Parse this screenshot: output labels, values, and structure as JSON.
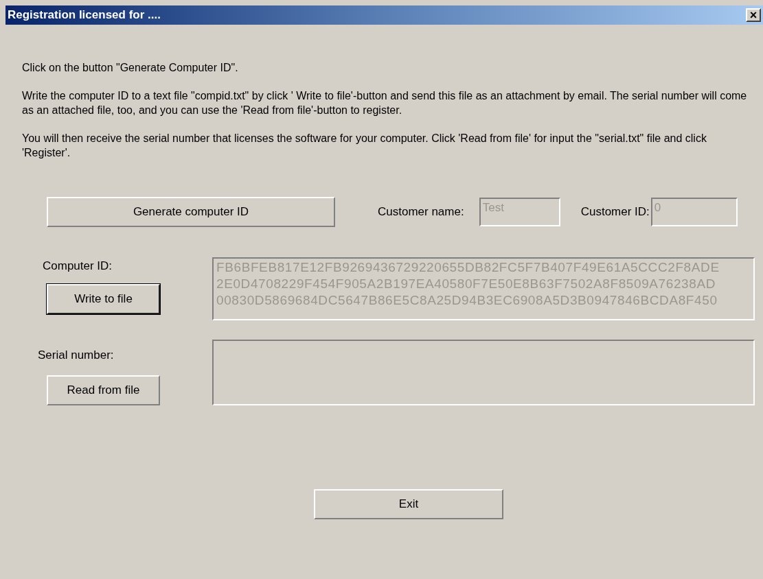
{
  "window": {
    "title": "Registration licensed for ....",
    "close": "×"
  },
  "instructions": [
    "Click on the button \"Generate Computer ID\".",
    "Write the computer ID to a text file \"compid.txt\" by click ' Write to file'-button and send this file as an attachment by email. The serial number will come as an attached file, too, and you can use the 'Read from file'-button to register.",
    "You will then receive the serial number that licenses the software for your computer. Click 'Read from file' for input the \"serial.txt\" file and click 'Register'."
  ],
  "generate_button": "Generate computer ID",
  "customer_name": {
    "label": "Customer name:",
    "value": "Test",
    "disabled": true
  },
  "customer_id": {
    "label": "Customer ID:",
    "value": "0",
    "disabled": true
  },
  "computer_id": {
    "label": "Computer ID:",
    "button": "Write to file",
    "button_focused": true,
    "disabled": true,
    "lines": [
      "FB6BFEB817E12FB9269436729220655DB82FC5F7B407F49E61A5CCC2F8ADE",
      "2E0D4708229F454F905A2B197EA40580F7E50E8B63F7502A8F8509A76238AD",
      "00830D5869684DC5647B86E5C8A25D94B3EC6908A5D3B0947846BCDA8F450"
    ]
  },
  "serial_number": {
    "label": "Serial number:",
    "button": "Read from file"
  },
  "exit_button": "Exit"
}
